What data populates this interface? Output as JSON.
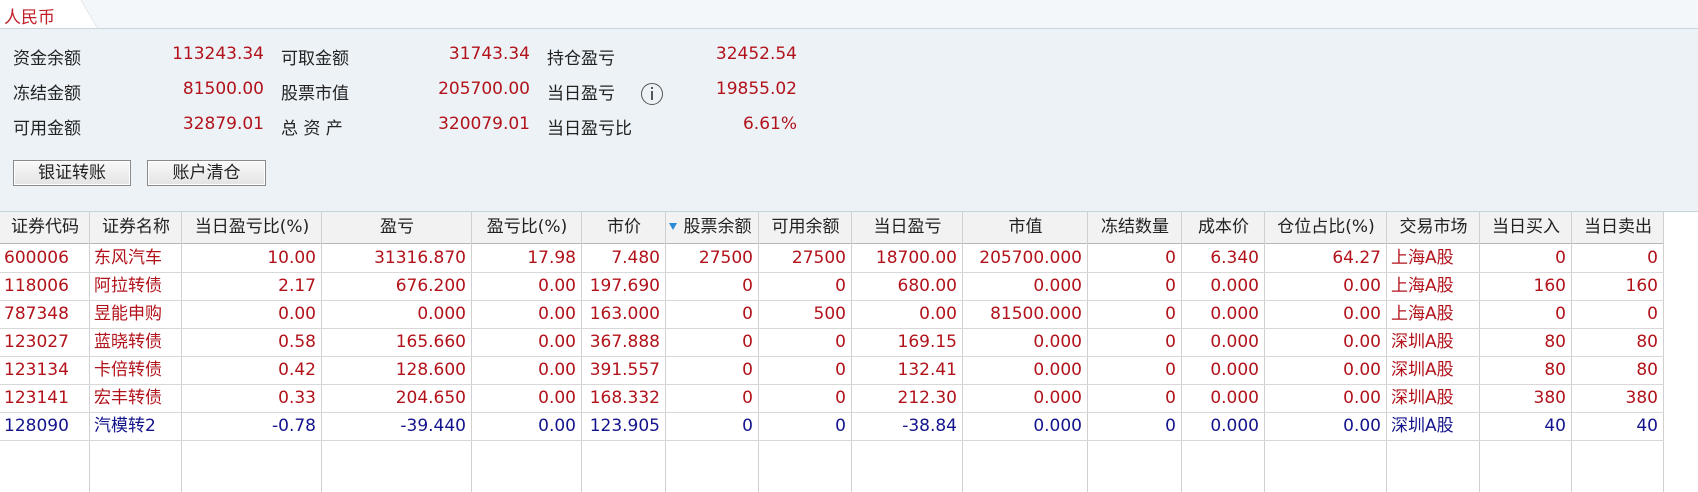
{
  "tab": {
    "label": "人民币"
  },
  "summary": [
    {
      "label": "资金余额",
      "value": "113243.34"
    },
    {
      "label": "可取金额",
      "value": "31743.34"
    },
    {
      "label": "持仓盈亏",
      "value": "32452.54"
    },
    {
      "label": "冻结金额",
      "value": "81500.00"
    },
    {
      "label": "股票市值",
      "value": "205700.00"
    },
    {
      "label": "当日盈亏",
      "value": "19855.02"
    },
    {
      "label": "可用金额",
      "value": "32879.01"
    },
    {
      "label": "总 资 产",
      "value": "320079.01"
    },
    {
      "label": "当日盈亏比",
      "value": "6.61%"
    }
  ],
  "buttons": {
    "transfer": "银证转账",
    "clear": "账户清仓"
  },
  "table": {
    "columns": [
      "证券代码",
      "证券名称",
      "当日盈亏比(%)",
      "盈亏",
      "盈亏比(%)",
      "市价",
      "股票余额",
      "可用余额",
      "当日盈亏",
      "市值",
      "冻结数量",
      "成本价",
      "仓位占比(%)",
      "交易市场",
      "当日买入",
      "当日卖出"
    ],
    "sorted_column": "股票余额",
    "rows": [
      [
        "600006",
        "东风汽车",
        "10.00",
        "31316.870",
        "17.98",
        "7.480",
        "27500",
        "27500",
        "18700.00",
        "205700.000",
        "0",
        "6.340",
        "64.27",
        "上海A股",
        "0",
        "0"
      ],
      [
        "118006",
        "阿拉转债",
        "2.17",
        "676.200",
        "0.00",
        "197.690",
        "0",
        "0",
        "680.00",
        "0.000",
        "0",
        "0.000",
        "0.00",
        "上海A股",
        "160",
        "160"
      ],
      [
        "787348",
        "昱能申购",
        "0.00",
        "0.000",
        "0.00",
        "163.000",
        "0",
        "500",
        "0.00",
        "81500.000",
        "0",
        "0.000",
        "0.00",
        "上海A股",
        "0",
        "0"
      ],
      [
        "123027",
        "蓝晓转债",
        "0.58",
        "165.660",
        "0.00",
        "367.888",
        "0",
        "0",
        "169.15",
        "0.000",
        "0",
        "0.000",
        "0.00",
        "深圳A股",
        "80",
        "80"
      ],
      [
        "123134",
        "卡倍转债",
        "0.42",
        "128.600",
        "0.00",
        "391.557",
        "0",
        "0",
        "132.41",
        "0.000",
        "0",
        "0.000",
        "0.00",
        "深圳A股",
        "80",
        "80"
      ],
      [
        "123141",
        "宏丰转债",
        "0.33",
        "204.650",
        "0.00",
        "168.332",
        "0",
        "0",
        "212.30",
        "0.000",
        "0",
        "0.000",
        "0.00",
        "深圳A股",
        "380",
        "380"
      ],
      [
        "128090",
        "汽模转2",
        "-0.78",
        "-39.440",
        "0.00",
        "123.905",
        "0",
        "0",
        "-38.84",
        "0.000",
        "0",
        "0.000",
        "0.00",
        "深圳A股",
        "40",
        "40"
      ]
    ],
    "row_colors": [
      "#b2131b",
      "#b2131b",
      "#b2131b",
      "#b2131b",
      "#b2131b",
      "#b2131b",
      "#14148c"
    ]
  },
  "colors": {
    "gain": "#b2131b",
    "loss": "#14148c",
    "tab_text": "#c0202a"
  }
}
